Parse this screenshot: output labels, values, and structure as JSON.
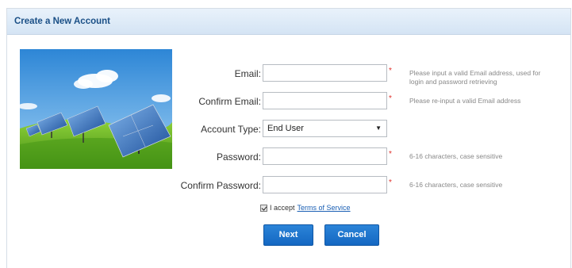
{
  "panel": {
    "title": "Create a New Account"
  },
  "form": {
    "email": {
      "label": "Email:",
      "value": "",
      "hint": "Please input a valid Email address, used for login and password retrieving",
      "required": "*"
    },
    "confirm_email": {
      "label": "Confirm Email:",
      "value": "",
      "hint": "Please re-input a valid Email address",
      "required": "*"
    },
    "account_type": {
      "label": "Account Type:",
      "selected": "End User"
    },
    "password": {
      "label": "Password:",
      "value": "",
      "hint": "6-16 characters, case sensitive",
      "required": "*"
    },
    "confirm_password": {
      "label": "Confirm Password:",
      "value": "",
      "hint": "6-16 characters, case sensitive",
      "required": "*"
    },
    "terms": {
      "prefix": "I accept",
      "link": "Terms of Service",
      "checked": true
    },
    "next_label": "Next",
    "cancel_label": "Cancel"
  },
  "image": {
    "subject": "solar-panels-on-grass-hill"
  },
  "colors": {
    "header_text": "#1a4f86",
    "button": "#1a72cc",
    "required": "#e0302b",
    "link": "#1a5fb4"
  }
}
